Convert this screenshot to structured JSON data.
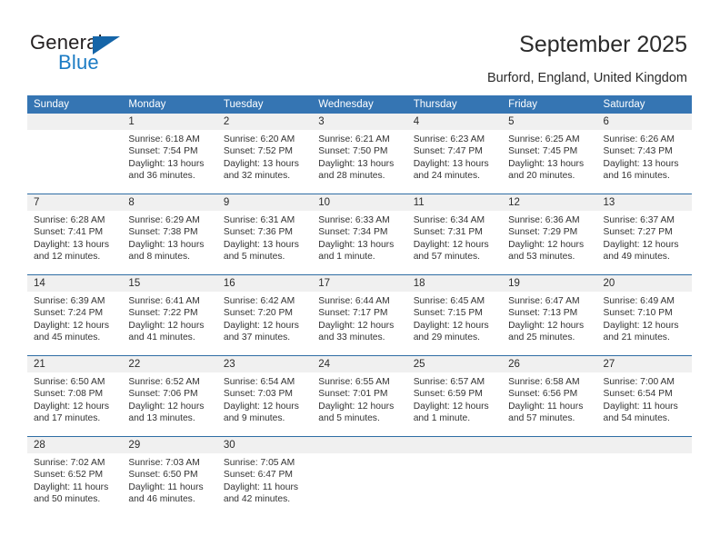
{
  "brand": {
    "name_top": "General",
    "name_bottom": "Blue",
    "accent_color": "#1b7bc4",
    "triangle_color": "#1565a8"
  },
  "header": {
    "title": "September 2025",
    "subtitle": "Burford, England, United Kingdom"
  },
  "theme": {
    "weekday_header_bg": "#3575b3",
    "weekday_header_text": "#ffffff",
    "row_divider": "#2e6da4",
    "date_band_bg": "#f0f0f0",
    "body_text": "#333333"
  },
  "weekdays": [
    "Sunday",
    "Monday",
    "Tuesday",
    "Wednesday",
    "Thursday",
    "Friday",
    "Saturday"
  ],
  "weeks": [
    [
      {
        "day": "",
        "sunrise": "",
        "sunset": "",
        "daylight_line1": "",
        "daylight_line2": "",
        "empty": true
      },
      {
        "day": "1",
        "sunrise": "Sunrise: 6:18 AM",
        "sunset": "Sunset: 7:54 PM",
        "daylight_line1": "Daylight: 13 hours",
        "daylight_line2": "and 36 minutes."
      },
      {
        "day": "2",
        "sunrise": "Sunrise: 6:20 AM",
        "sunset": "Sunset: 7:52 PM",
        "daylight_line1": "Daylight: 13 hours",
        "daylight_line2": "and 32 minutes."
      },
      {
        "day": "3",
        "sunrise": "Sunrise: 6:21 AM",
        "sunset": "Sunset: 7:50 PM",
        "daylight_line1": "Daylight: 13 hours",
        "daylight_line2": "and 28 minutes."
      },
      {
        "day": "4",
        "sunrise": "Sunrise: 6:23 AM",
        "sunset": "Sunset: 7:47 PM",
        "daylight_line1": "Daylight: 13 hours",
        "daylight_line2": "and 24 minutes."
      },
      {
        "day": "5",
        "sunrise": "Sunrise: 6:25 AM",
        "sunset": "Sunset: 7:45 PM",
        "daylight_line1": "Daylight: 13 hours",
        "daylight_line2": "and 20 minutes."
      },
      {
        "day": "6",
        "sunrise": "Sunrise: 6:26 AM",
        "sunset": "Sunset: 7:43 PM",
        "daylight_line1": "Daylight: 13 hours",
        "daylight_line2": "and 16 minutes."
      }
    ],
    [
      {
        "day": "7",
        "sunrise": "Sunrise: 6:28 AM",
        "sunset": "Sunset: 7:41 PM",
        "daylight_line1": "Daylight: 13 hours",
        "daylight_line2": "and 12 minutes."
      },
      {
        "day": "8",
        "sunrise": "Sunrise: 6:29 AM",
        "sunset": "Sunset: 7:38 PM",
        "daylight_line1": "Daylight: 13 hours",
        "daylight_line2": "and 8 minutes."
      },
      {
        "day": "9",
        "sunrise": "Sunrise: 6:31 AM",
        "sunset": "Sunset: 7:36 PM",
        "daylight_line1": "Daylight: 13 hours",
        "daylight_line2": "and 5 minutes."
      },
      {
        "day": "10",
        "sunrise": "Sunrise: 6:33 AM",
        "sunset": "Sunset: 7:34 PM",
        "daylight_line1": "Daylight: 13 hours",
        "daylight_line2": "and 1 minute."
      },
      {
        "day": "11",
        "sunrise": "Sunrise: 6:34 AM",
        "sunset": "Sunset: 7:31 PM",
        "daylight_line1": "Daylight: 12 hours",
        "daylight_line2": "and 57 minutes."
      },
      {
        "day": "12",
        "sunrise": "Sunrise: 6:36 AM",
        "sunset": "Sunset: 7:29 PM",
        "daylight_line1": "Daylight: 12 hours",
        "daylight_line2": "and 53 minutes."
      },
      {
        "day": "13",
        "sunrise": "Sunrise: 6:37 AM",
        "sunset": "Sunset: 7:27 PM",
        "daylight_line1": "Daylight: 12 hours",
        "daylight_line2": "and 49 minutes."
      }
    ],
    [
      {
        "day": "14",
        "sunrise": "Sunrise: 6:39 AM",
        "sunset": "Sunset: 7:24 PM",
        "daylight_line1": "Daylight: 12 hours",
        "daylight_line2": "and 45 minutes."
      },
      {
        "day": "15",
        "sunrise": "Sunrise: 6:41 AM",
        "sunset": "Sunset: 7:22 PM",
        "daylight_line1": "Daylight: 12 hours",
        "daylight_line2": "and 41 minutes."
      },
      {
        "day": "16",
        "sunrise": "Sunrise: 6:42 AM",
        "sunset": "Sunset: 7:20 PM",
        "daylight_line1": "Daylight: 12 hours",
        "daylight_line2": "and 37 minutes."
      },
      {
        "day": "17",
        "sunrise": "Sunrise: 6:44 AM",
        "sunset": "Sunset: 7:17 PM",
        "daylight_line1": "Daylight: 12 hours",
        "daylight_line2": "and 33 minutes."
      },
      {
        "day": "18",
        "sunrise": "Sunrise: 6:45 AM",
        "sunset": "Sunset: 7:15 PM",
        "daylight_line1": "Daylight: 12 hours",
        "daylight_line2": "and 29 minutes."
      },
      {
        "day": "19",
        "sunrise": "Sunrise: 6:47 AM",
        "sunset": "Sunset: 7:13 PM",
        "daylight_line1": "Daylight: 12 hours",
        "daylight_line2": "and 25 minutes."
      },
      {
        "day": "20",
        "sunrise": "Sunrise: 6:49 AM",
        "sunset": "Sunset: 7:10 PM",
        "daylight_line1": "Daylight: 12 hours",
        "daylight_line2": "and 21 minutes."
      }
    ],
    [
      {
        "day": "21",
        "sunrise": "Sunrise: 6:50 AM",
        "sunset": "Sunset: 7:08 PM",
        "daylight_line1": "Daylight: 12 hours",
        "daylight_line2": "and 17 minutes."
      },
      {
        "day": "22",
        "sunrise": "Sunrise: 6:52 AM",
        "sunset": "Sunset: 7:06 PM",
        "daylight_line1": "Daylight: 12 hours",
        "daylight_line2": "and 13 minutes."
      },
      {
        "day": "23",
        "sunrise": "Sunrise: 6:54 AM",
        "sunset": "Sunset: 7:03 PM",
        "daylight_line1": "Daylight: 12 hours",
        "daylight_line2": "and 9 minutes."
      },
      {
        "day": "24",
        "sunrise": "Sunrise: 6:55 AM",
        "sunset": "Sunset: 7:01 PM",
        "daylight_line1": "Daylight: 12 hours",
        "daylight_line2": "and 5 minutes."
      },
      {
        "day": "25",
        "sunrise": "Sunrise: 6:57 AM",
        "sunset": "Sunset: 6:59 PM",
        "daylight_line1": "Daylight: 12 hours",
        "daylight_line2": "and 1 minute."
      },
      {
        "day": "26",
        "sunrise": "Sunrise: 6:58 AM",
        "sunset": "Sunset: 6:56 PM",
        "daylight_line1": "Daylight: 11 hours",
        "daylight_line2": "and 57 minutes."
      },
      {
        "day": "27",
        "sunrise": "Sunrise: 7:00 AM",
        "sunset": "Sunset: 6:54 PM",
        "daylight_line1": "Daylight: 11 hours",
        "daylight_line2": "and 54 minutes."
      }
    ],
    [
      {
        "day": "28",
        "sunrise": "Sunrise: 7:02 AM",
        "sunset": "Sunset: 6:52 PM",
        "daylight_line1": "Daylight: 11 hours",
        "daylight_line2": "and 50 minutes."
      },
      {
        "day": "29",
        "sunrise": "Sunrise: 7:03 AM",
        "sunset": "Sunset: 6:50 PM",
        "daylight_line1": "Daylight: 11 hours",
        "daylight_line2": "and 46 minutes."
      },
      {
        "day": "30",
        "sunrise": "Sunrise: 7:05 AM",
        "sunset": "Sunset: 6:47 PM",
        "daylight_line1": "Daylight: 11 hours",
        "daylight_line2": "and 42 minutes."
      },
      {
        "day": "",
        "sunrise": "",
        "sunset": "",
        "daylight_line1": "",
        "daylight_line2": "",
        "empty": true
      },
      {
        "day": "",
        "sunrise": "",
        "sunset": "",
        "daylight_line1": "",
        "daylight_line2": "",
        "empty": true
      },
      {
        "day": "",
        "sunrise": "",
        "sunset": "",
        "daylight_line1": "",
        "daylight_line2": "",
        "empty": true
      },
      {
        "day": "",
        "sunrise": "",
        "sunset": "",
        "daylight_line1": "",
        "daylight_line2": "",
        "empty": true
      }
    ]
  ]
}
